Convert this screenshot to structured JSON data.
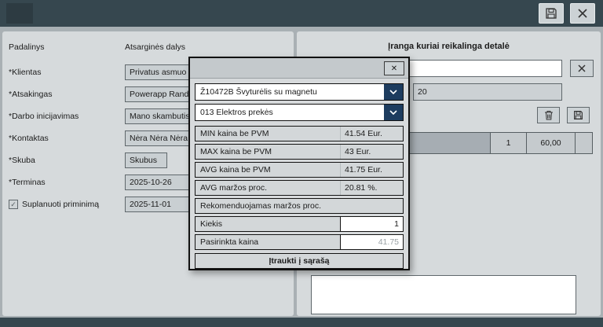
{
  "glyphs": {
    "check": "✓",
    "close": "✕"
  },
  "colors": {
    "header_bg": "#36474f",
    "panel_bg": "#d6dadc",
    "accent_navy": "#1d3c5f"
  },
  "left_panel": {
    "column1_header": "Padalinys",
    "column2_header": "Atsarginės dalys",
    "fields": [
      {
        "label": "*Klientas",
        "value": "Privatus asmuo"
      },
      {
        "label": "*Atsakingas",
        "value": "Powerapp Randv"
      },
      {
        "label": "*Darbo inicijavimas",
        "value": "Mano skambutis"
      },
      {
        "label": "*Kontaktas",
        "value": "Nėra Nėra Nėra"
      },
      {
        "label": "*Skuba",
        "value": "Skubus"
      },
      {
        "label": "*Terminas",
        "value": "2025-10-26"
      },
      {
        "label": "Suplanuoti priminimą",
        "value": "2025-11-01",
        "checkbox": true,
        "checked": true
      }
    ]
  },
  "right_panel": {
    "title": "Įranga kuriai reikalinga detalė",
    "search_value": "",
    "qty_value": "20",
    "row": {
      "qty": "1",
      "price": "60,00"
    }
  },
  "modal": {
    "part_select": "Ž10472B Švyturėlis su magnetu",
    "category_select": "013 Elektros prekės",
    "stats": [
      {
        "label": "MIN kaina be PVM",
        "value": "41.54 Eur."
      },
      {
        "label": "MAX kaina be PVM",
        "value": "43 Eur."
      },
      {
        "label": "AVG kaina be PVM",
        "value": "41.75 Eur."
      },
      {
        "label": "AVG maržos proc.",
        "value": "20.81 %."
      },
      {
        "label": "Rekomenduojamas maržos proc.",
        "value": ""
      }
    ],
    "kiekis_label": "Kiekis",
    "kiekis_value": "1",
    "kaina_label": "Pasirinkta kaina",
    "kaina_value": "41.75",
    "add_button": "Įtraukti į sąrašą"
  }
}
